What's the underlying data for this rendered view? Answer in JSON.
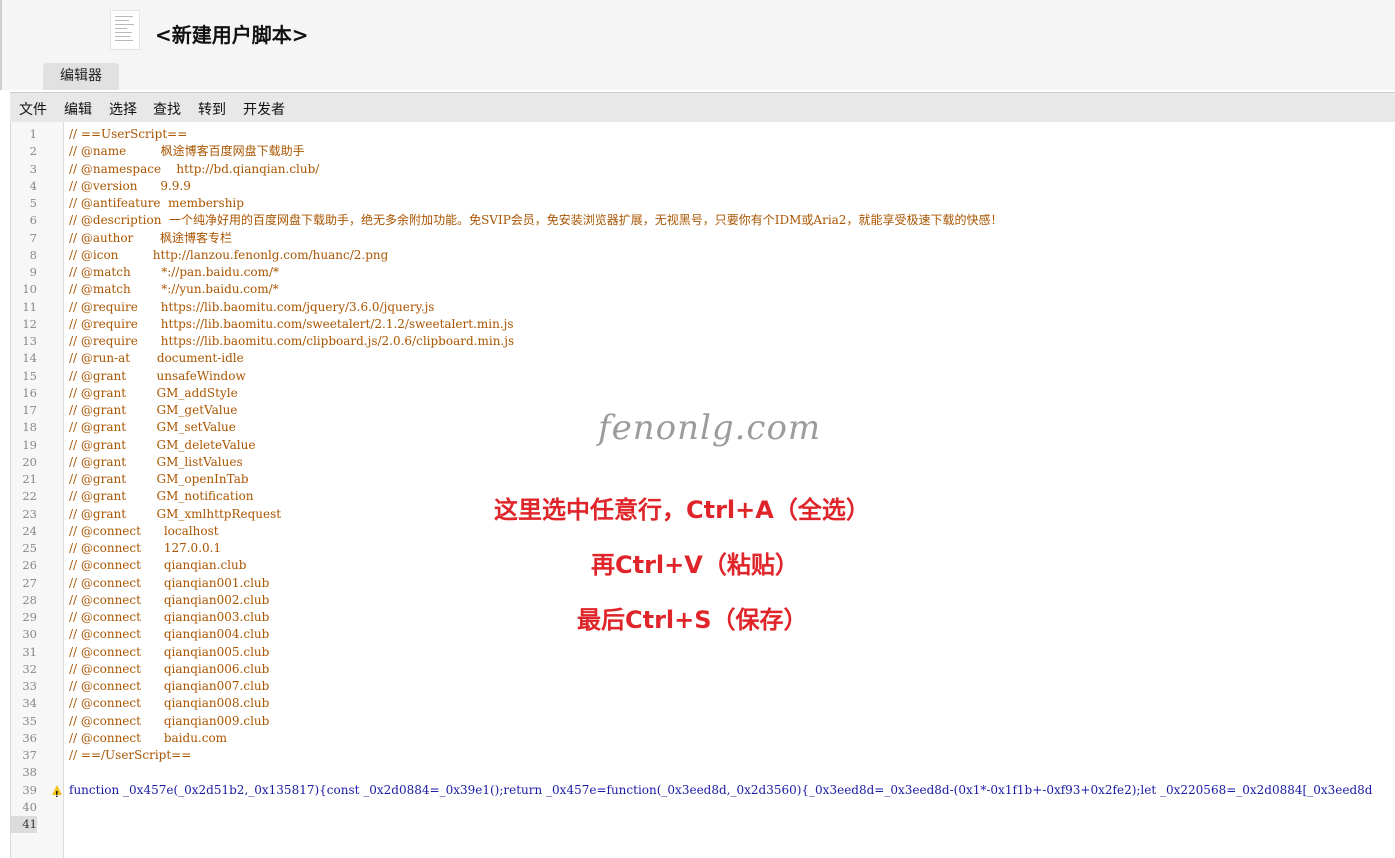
{
  "header": {
    "title": "<新建用户脚本>",
    "tab_label": "编辑器"
  },
  "menu": [
    "文件",
    "编辑",
    "选择",
    "查找",
    "转到",
    "开发者"
  ],
  "editor": {
    "lines": [
      "// ==UserScript==",
      "// @name         枫途博客百度网盘下载助手",
      "// @namespace    http://bd.qianqian.club/",
      "// @version      9.9.9",
      "// @antifeature  membership",
      "// @description  一个纯净好用的百度网盘下载助手，绝无多余附加功能。免SVIP会员，免安装浏览器扩展，无视黑号，只要你有个IDM或Aria2，就能享受极速下载的快感！",
      "// @author       枫途博客专栏",
      "// @icon         http://lanzou.fenonlg.com/huanc/2.png",
      "// @match        *://pan.baidu.com/*",
      "// @match        *://yun.baidu.com/*",
      "// @require      https://lib.baomitu.com/jquery/3.6.0/jquery.js",
      "// @require      https://lib.baomitu.com/sweetalert/2.1.2/sweetalert.min.js",
      "// @require      https://lib.baomitu.com/clipboard.js/2.0.6/clipboard.min.js",
      "// @run-at       document-idle",
      "// @grant        unsafeWindow",
      "// @grant        GM_addStyle",
      "// @grant        GM_getValue",
      "// @grant        GM_setValue",
      "// @grant        GM_deleteValue",
      "// @grant        GM_listValues",
      "// @grant        GM_openInTab",
      "// @grant        GM_notification",
      "// @grant        GM_xmlhttpRequest",
      "// @connect      localhost",
      "// @connect      127.0.0.1",
      "// @connect      qianqian.club",
      "// @connect      qianqian001.club",
      "// @connect      qianqian002.club",
      "// @connect      qianqian003.club",
      "// @connect      qianqian004.club",
      "// @connect      qianqian005.club",
      "// @connect      qianqian006.club",
      "// @connect      qianqian007.club",
      "// @connect      qianqian008.club",
      "// @connect      qianqian009.club",
      "// @connect      baidu.com",
      "// ==/UserScript==",
      "",
      "function _0x457e(_0x2d51b2,_0x135817){const _0x2d0884=_0x39e1();return _0x457e=function(_0x3eed8d,_0x2d3560){_0x3eed8d=_0x3eed8d-(0x1*-0x1f1b+-0xf93+0x2fe2);let _0x220568=_0x2d0884[_0x3eed8d",
      "",
      ""
    ],
    "warning_line": 39,
    "current_line": 41
  },
  "watermark": "fenonlg.com",
  "instructions": [
    "这里选中任意行，Ctrl+A（全选）",
    "再Ctrl+V（粘贴）",
    "最后Ctrl+S（保存）"
  ]
}
